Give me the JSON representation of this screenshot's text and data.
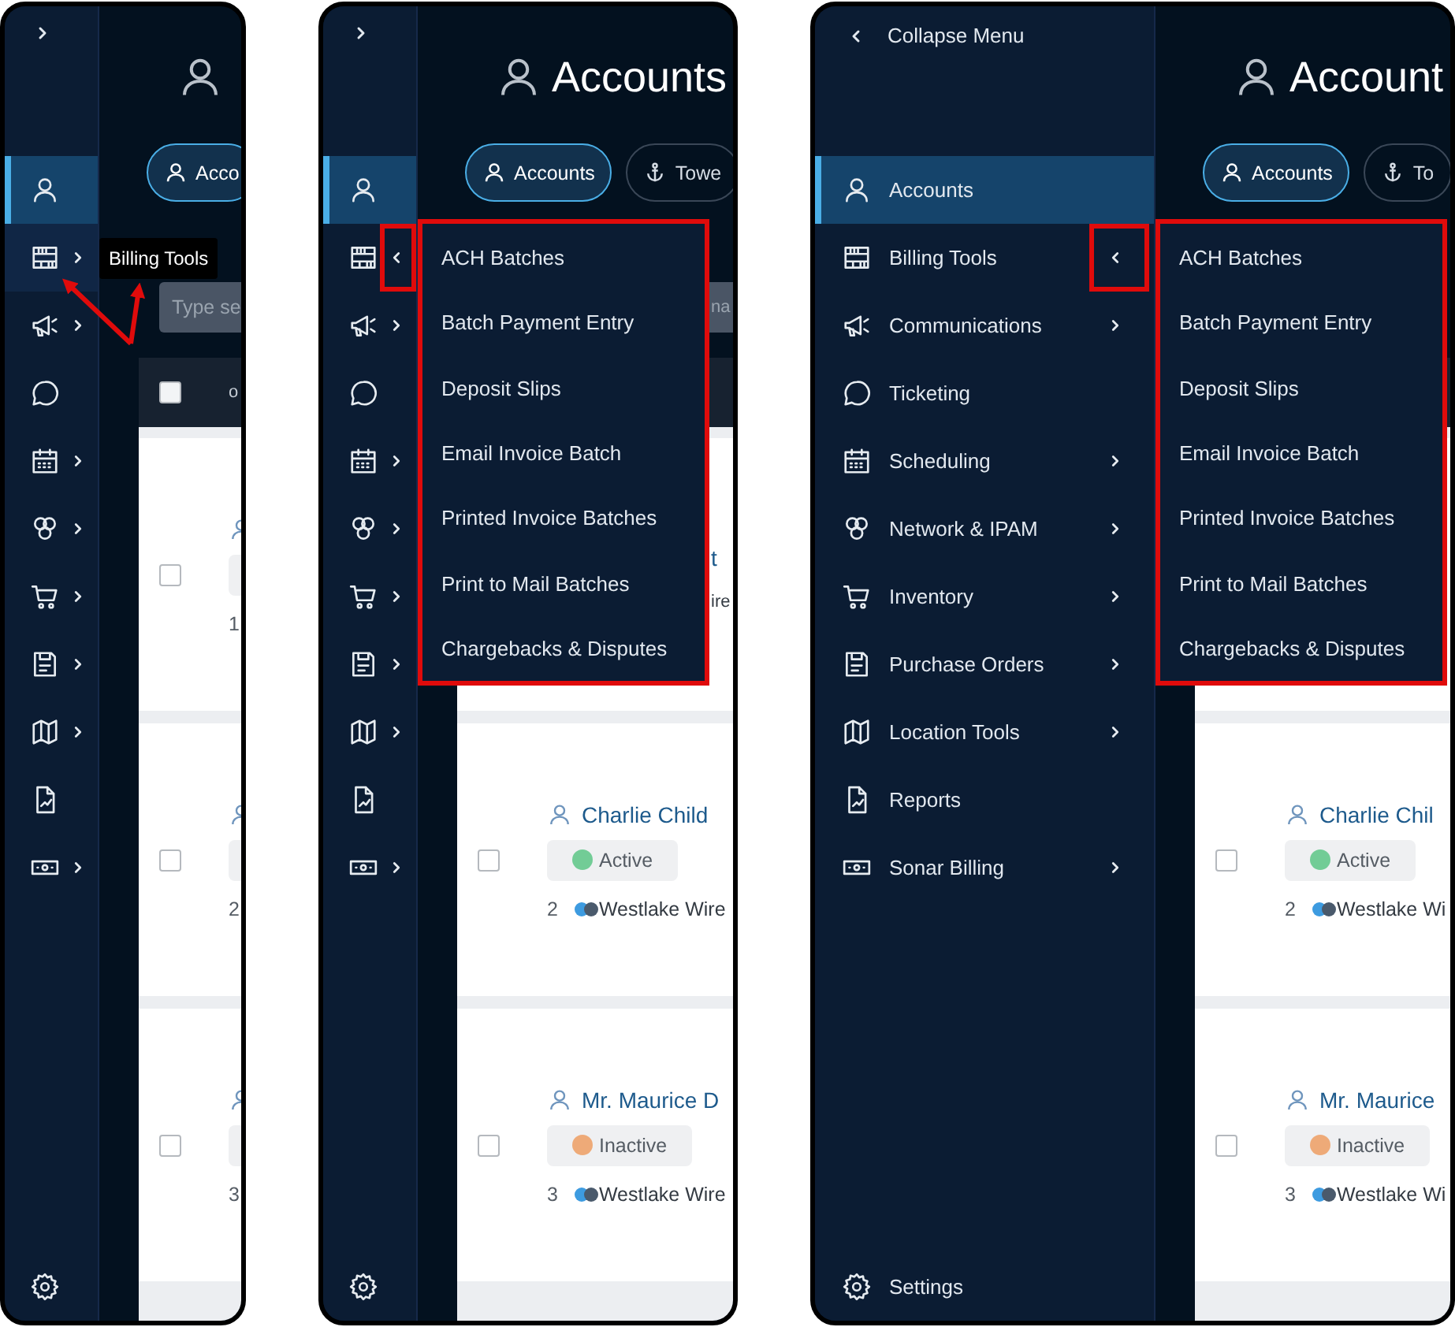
{
  "panels": [
    {
      "sidebar": {
        "expanded": false,
        "items": [
          {
            "selected": true,
            "submenu": false,
            "hovered": false
          },
          {
            "selected": false,
            "submenu": true,
            "open": false,
            "hovered": true
          },
          {
            "selected": false,
            "submenu": true,
            "open": false,
            "hovered": false
          },
          {
            "selected": false,
            "submenu": false,
            "hovered": false
          },
          {
            "selected": false,
            "submenu": true,
            "open": false,
            "hovered": false
          },
          {
            "selected": false,
            "submenu": true,
            "open": false,
            "hovered": false
          },
          {
            "selected": false,
            "submenu": true,
            "open": false,
            "hovered": false
          },
          {
            "selected": false,
            "submenu": true,
            "open": false,
            "hovered": false
          },
          {
            "selected": false,
            "submenu": true,
            "open": false,
            "hovered": false
          },
          {
            "selected": false,
            "submenu": false,
            "hovered": false
          },
          {
            "selected": false,
            "submenu": true,
            "open": false,
            "hovered": false
          }
        ]
      },
      "tooltip": "Billing Tools",
      "annotation": {
        "kind": "arrows"
      },
      "content": {
        "tabs": [
          {
            "label": "Acco",
            "selected": true
          }
        ],
        "search": {
          "placeholder": "Type se",
          "covered": false
        },
        "table_header": {
          "label": "o",
          "checked": false
        },
        "rows": [
          {
            "covered": false,
            "checked": false,
            "number": "1"
          },
          {
            "covered": false,
            "checked": false,
            "number": "2"
          },
          {
            "covered": false,
            "checked": false,
            "number": "3"
          }
        ]
      }
    },
    {
      "sidebar": {
        "expanded": false,
        "items": [
          {
            "selected": true,
            "submenu": false,
            "hovered": false
          },
          {
            "selected": false,
            "submenu": true,
            "open": true,
            "hovered": false
          },
          {
            "selected": false,
            "submenu": true,
            "open": false,
            "hovered": false
          },
          {
            "selected": false,
            "submenu": false,
            "hovered": false
          },
          {
            "selected": false,
            "submenu": true,
            "open": false,
            "hovered": false
          },
          {
            "selected": false,
            "submenu": true,
            "open": false,
            "hovered": false
          },
          {
            "selected": false,
            "submenu": true,
            "open": false,
            "hovered": false
          },
          {
            "selected": false,
            "submenu": true,
            "open": false,
            "hovered": false
          },
          {
            "selected": false,
            "submenu": true,
            "open": false,
            "hovered": false
          },
          {
            "selected": false,
            "submenu": false,
            "hovered": false
          },
          {
            "selected": false,
            "submenu": true,
            "open": false,
            "hovered": false
          }
        ]
      },
      "annotation": {
        "kind": "boxes"
      },
      "flyout": [
        "ACH Batches",
        "Batch Payment Entry",
        "Deposit Slips",
        "Email Invoice Batch",
        "Printed Invoice Batches",
        "Print to Mail Batches",
        "Chargebacks & Disputes"
      ],
      "content": {
        "title": "Accounts",
        "tabs": [
          {
            "label": "Accounts",
            "selected": true
          },
          {
            "label": "Towe",
            "selected": false
          }
        ],
        "search": {
          "placeholder": "na",
          "covered": true
        },
        "rows": [
          {
            "covered": true,
            "name": "t",
            "company": "ire"
          },
          {
            "covered": false,
            "checked": false,
            "name": "Charlie Child",
            "status": {
              "label": "Active",
              "color": "#72cc96"
            },
            "number": "2",
            "company": "Westlake Wire"
          },
          {
            "covered": false,
            "checked": false,
            "name": "Mr. Maurice D",
            "status": {
              "label": "Inactive",
              "color": "#eeaa78"
            },
            "number": "3",
            "company": "Westlake Wire"
          }
        ]
      }
    },
    {
      "sidebar": {
        "expanded": true,
        "toggle_label": "Collapse Menu",
        "settings_label": "Settings",
        "items": [
          {
            "label": "Accounts",
            "selected": true,
            "submenu": false,
            "hovered": false
          },
          {
            "label": "Billing Tools",
            "selected": false,
            "submenu": true,
            "open": true,
            "hovered": false
          },
          {
            "label": "Communications",
            "selected": false,
            "submenu": true,
            "open": false,
            "hovered": false
          },
          {
            "label": "Ticketing",
            "selected": false,
            "submenu": false,
            "hovered": false
          },
          {
            "label": "Scheduling",
            "selected": false,
            "submenu": true,
            "open": false,
            "hovered": false
          },
          {
            "label": "Network & IPAM",
            "selected": false,
            "submenu": true,
            "open": false,
            "hovered": false
          },
          {
            "label": "Inventory",
            "selected": false,
            "submenu": true,
            "open": false,
            "hovered": false
          },
          {
            "label": "Purchase Orders",
            "selected": false,
            "submenu": true,
            "open": false,
            "hovered": false
          },
          {
            "label": "Location Tools",
            "selected": false,
            "submenu": true,
            "open": false,
            "hovered": false
          },
          {
            "label": "Reports",
            "selected": false,
            "submenu": false,
            "hovered": false
          },
          {
            "label": "Sonar Billing",
            "selected": false,
            "submenu": true,
            "open": false,
            "hovered": false
          }
        ]
      },
      "annotation": {
        "kind": "boxes"
      },
      "flyout": [
        "ACH Batches",
        "Batch Payment Entry",
        "Deposit Slips",
        "Email Invoice Batch",
        "Printed Invoice Batches",
        "Print to Mail Batches",
        "Chargebacks & Disputes"
      ],
      "content": {
        "title": "Account",
        "tabs": [
          {
            "label": "Accounts",
            "selected": true
          },
          {
            "label": "To",
            "selected": false
          }
        ],
        "rows": [
          {
            "covered": true
          },
          {
            "covered": false,
            "checked": false,
            "name": "Charlie Chil",
            "status": {
              "label": "Active",
              "color": "#72cc96"
            },
            "number": "2",
            "company": "Westlake Wi"
          },
          {
            "covered": false,
            "checked": false,
            "name": "Mr. Maurice",
            "status": {
              "label": "Inactive",
              "color": "#eeaa78"
            },
            "number": "3",
            "company": "Westlake Wi"
          }
        ]
      }
    }
  ]
}
